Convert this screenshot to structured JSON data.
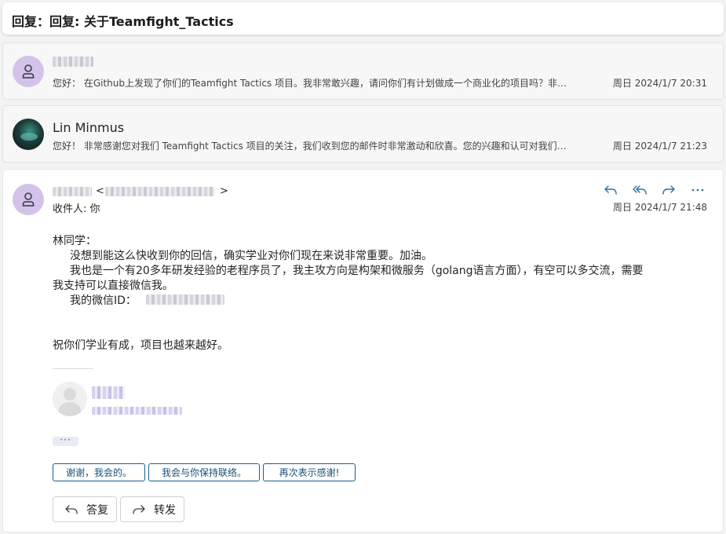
{
  "subject": "回复：回复: 关于Teamfight_Tactics",
  "messages": [
    {
      "sender": "",
      "preview": "您好： 在Github上发现了你们的Teamfight Tactics 项目。我非常敢兴趣，请问你们有计划做成一个商业化的项目吗？非常...",
      "date": "周日 2024/1/7 20:31"
    },
    {
      "sender": "Lin Minmus",
      "preview": "您好！ 非常感谢您对我们 Teamfight Tactics 项目的关注，我们收到您的邮件时非常激动和欣喜。您的兴趣和认可对我们来...",
      "date": "周日 2024/1/7 21:23"
    }
  ],
  "open_message": {
    "from_open": "<",
    "from_close": ">",
    "to_line": "收件人: 你",
    "date": "周日 2024/1/7 21:48",
    "greeting": "林同学：",
    "line1": "没想到能这么快收到你的回信，确实学业对你们现在来说非常重要。加油。",
    "line2a": "我也是一个有20多年研发经验的老程序员了，我主攻方向是构架和微服务（golang语言方面），有空可以多交流，需要",
    "line2b": "我支持可以直接微信我。",
    "wechat_label": "我的微信ID：",
    "closing": "祝你们学业有成，项目也越来越好。",
    "more": "···"
  },
  "actions": {
    "reply": "reply-icon",
    "reply_all": "reply-all-icon",
    "forward": "forward-icon",
    "more": "more-icon"
  },
  "quick_replies": [
    "谢谢，我会的。",
    "我会与你保持联络。",
    "再次表示感谢!"
  ],
  "buttons": {
    "reply_label": "答复",
    "forward_label": "转发"
  },
  "colors": {
    "accent": "#1d5f8c",
    "avatar_purple": "#d3c3ea"
  }
}
